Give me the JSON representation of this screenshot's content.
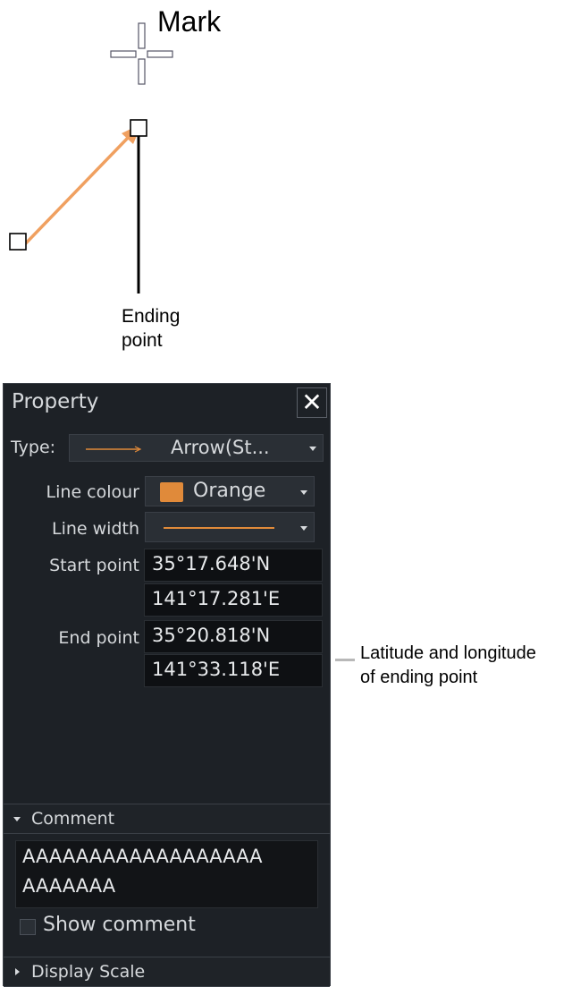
{
  "annotations": {
    "mark_label": "Mark",
    "ending_point_label_line1": "Ending",
    "ending_point_label_line2": "point",
    "latlon_label_line1": "Latitude and longitude",
    "latlon_label_line2": "of ending point"
  },
  "panel": {
    "title": "Property",
    "close_icon": "close-icon",
    "type": {
      "label": "Type:",
      "value": "Arrow(St..."
    },
    "line_colour": {
      "label": "Line colour",
      "value": "Orange",
      "swatch": "#e08a3a"
    },
    "line_width": {
      "label": "Line width"
    },
    "start_point": {
      "label": "Start point",
      "lat": "35°17.648'N",
      "lon": "141°17.281'E"
    },
    "end_point": {
      "label": "End point",
      "lat": "35°20.818'N",
      "lon": "141°33.118'E"
    },
    "comment": {
      "header": "Comment",
      "text_line1": "AAAAAAAAAAAAAAAAAA",
      "text_line2": "AAAAAAA",
      "show_comment_label": "Show comment",
      "show_comment_checked": false
    },
    "display_scale": {
      "header": "Display Scale"
    }
  },
  "colors": {
    "arrow": "#f0a060",
    "panel_bg": "#1d2126"
  }
}
